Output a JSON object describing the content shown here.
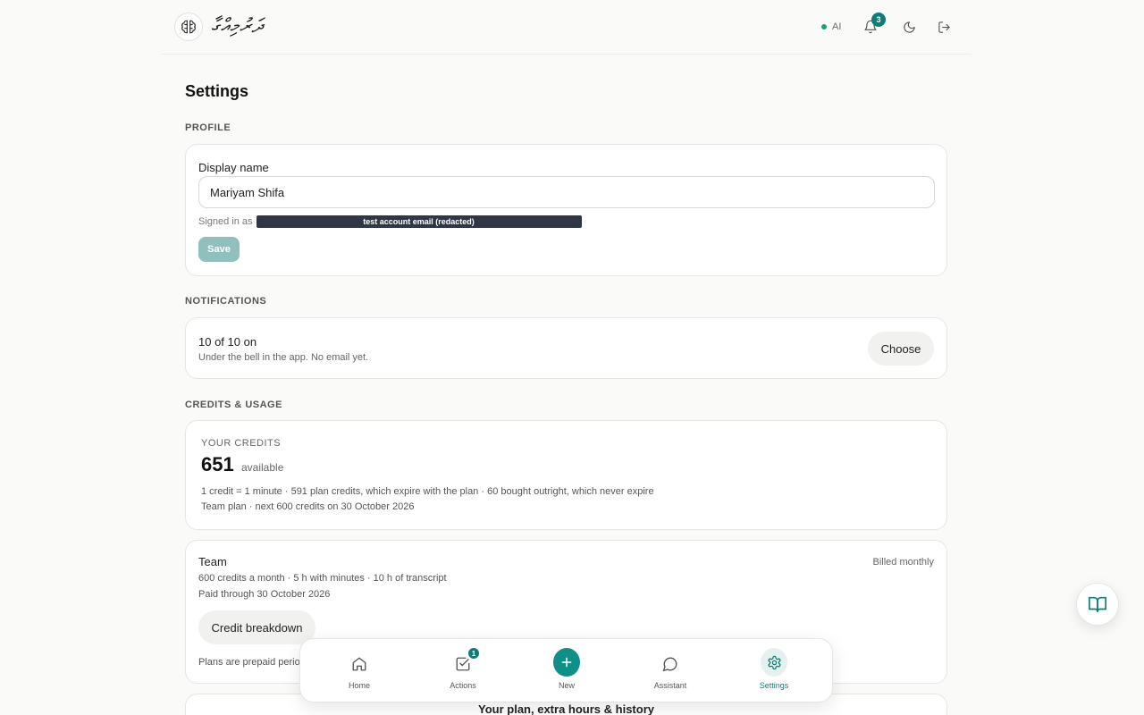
{
  "header": {
    "brand": "ދަރުމިއްގާ",
    "ai_label": "AI",
    "notification_count": "3"
  },
  "page": {
    "title": "Settings"
  },
  "profile": {
    "section_label": "PROFILE",
    "display_name_label": "Display name",
    "display_name_value": "Mariyam Shifa",
    "signed_in_prefix": "Signed in as",
    "email_redacted": "test account email (redacted)",
    "save_label": "Save"
  },
  "notifications": {
    "section_label": "NOTIFICATIONS",
    "title": "10 of 10 on",
    "subtitle": "Under the bell in the app. No email yet.",
    "choose_label": "Choose"
  },
  "credits": {
    "section_label": "CREDITS & USAGE",
    "your_credits_label": "YOUR CREDITS",
    "amount": "651",
    "available_label": "available",
    "line1": "1 credit = 1 minute · 591 plan credits, which expire with the plan · 60 bought outright, which never expire",
    "line2": "Team plan · next 600 credits on 30 October 2026"
  },
  "plan": {
    "name": "Team",
    "billing": "Billed monthly",
    "line1": "600 credits a month · 5 h with minutes · 10 h of transcript",
    "line2": "Paid through 30 October 2026",
    "breakdown_label": "Credit breakdown",
    "note": "Plans are prepaid perio"
  },
  "history_card": {
    "title": "Your plan, extra hours & history"
  },
  "bottom_nav": {
    "home": "Home",
    "actions": "Actions",
    "actions_badge": "1",
    "new": "New",
    "assistant": "Assistant",
    "settings": "Settings"
  },
  "colors": {
    "accent": "#0e7d7a",
    "accent_button": "#0e8f88",
    "save_disabled": "#8fc0bc",
    "ai_status": "#16a36a"
  }
}
